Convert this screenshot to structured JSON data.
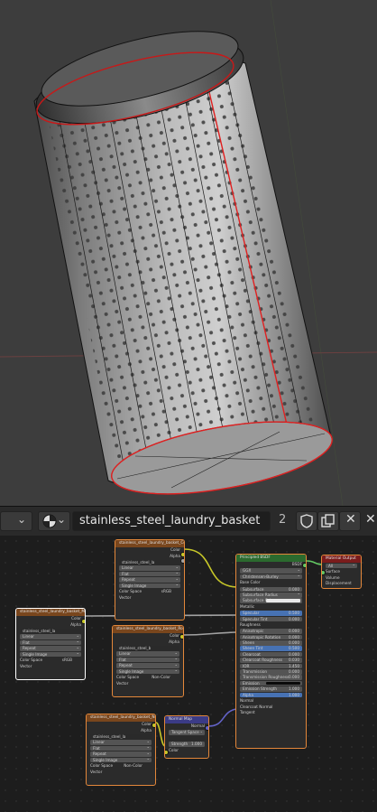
{
  "material_name": "stainless_steel_laundry_basket",
  "user_count": "2",
  "icons": {
    "editor_type": "node-editor-icon",
    "material_slot": "material-sphere-icon",
    "fake_user": "shield-icon",
    "duplicate": "duplicate-icon",
    "unlink": "close-icon",
    "pin": "pin-icon"
  },
  "colors": {
    "viewport_bg": "#3d3d3d",
    "editor_bg": "#1d1d1d",
    "texture_header": "#79461d",
    "bsdf_header": "#2b6a2e",
    "output_header": "#7a1c1c",
    "vector_header": "#3b3b86",
    "selection": "#e3873a",
    "edge_seam": "#e02020"
  },
  "nodes": {
    "tex_color": {
      "title": "stainless_steel_laundry_basket_Co.jpg",
      "out_color": "Color",
      "out_alpha": "Alpha",
      "image": "stainless_steel_la",
      "interpolation": "Linear",
      "projection": "Flat",
      "extension": "Repeat",
      "source": "Single Image",
      "colorspace_label": "Color Space",
      "colorspace": "sRGB",
      "vector": "Vector"
    },
    "tex_metal": {
      "title": "stainless_steel_laundry_basket_Metal.jpg",
      "out_color": "Color",
      "out_alpha": "Alpha",
      "image": "stainless_steel_la",
      "interpolation": "Linear",
      "projection": "Flat",
      "extension": "Repeat",
      "source": "Single Image",
      "colorspace_label": "Color Space",
      "colorspace": "sRGB",
      "vector": "Vector"
    },
    "tex_rough": {
      "title": "stainless_steel_laundry_basket_Rough.jpg",
      "out_color": "Color",
      "out_alpha": "Alpha",
      "image": "stainless_steel_b",
      "interpolation": "Linear",
      "projection": "Flat",
      "extension": "Repeat",
      "source": "Single Image",
      "colorspace_label": "Color Space",
      "colorspace": "Non-Color",
      "vector": "Vector"
    },
    "tex_normal": {
      "title": "stainless_steel_laundry_basket_Normal.jpg",
      "out_color": "Color",
      "out_alpha": "Alpha",
      "image": "stainless_steel_la",
      "interpolation": "Linear",
      "projection": "Flat",
      "extension": "Repeat",
      "source": "Single Image",
      "colorspace_label": "Color Space",
      "colorspace": "Non-Color",
      "vector": "Vector"
    },
    "normal_map": {
      "title": "Normal Map",
      "out_normal": "Normal",
      "space": "Tangent Space",
      "uv": "",
      "strength_label": "Strength",
      "strength": "1.000",
      "in_color": "Color"
    },
    "bsdf": {
      "title": "Principled BSDF",
      "out_bsdf": "BSDF",
      "distribution": "GGX",
      "subsurface_method": "Christensen-Burley",
      "rows": [
        {
          "label": "Base Color",
          "value": "",
          "kind": "socket"
        },
        {
          "label": "Subsurface",
          "value": "0.000",
          "kind": "field"
        },
        {
          "label": "Subsurface Radius",
          "value": "",
          "kind": "drop"
        },
        {
          "label": "Subsurface Col",
          "value": "",
          "kind": "color"
        },
        {
          "label": "Metallic",
          "value": "",
          "kind": "socket"
        },
        {
          "label": "Specular",
          "value": "0.500",
          "kind": "blue"
        },
        {
          "label": "Specular Tint",
          "value": "0.000",
          "kind": "field"
        },
        {
          "label": "Roughness",
          "value": "",
          "kind": "socket"
        },
        {
          "label": "Anisotropic",
          "value": "0.000",
          "kind": "field"
        },
        {
          "label": "Anisotropic Rotation",
          "value": "0.000",
          "kind": "field"
        },
        {
          "label": "Sheen",
          "value": "0.000",
          "kind": "field"
        },
        {
          "label": "Sheen Tint",
          "value": "0.500",
          "kind": "blue"
        },
        {
          "label": "Clearcoat",
          "value": "0.000",
          "kind": "field"
        },
        {
          "label": "Clearcoat Roughness",
          "value": "0.030",
          "kind": "field"
        },
        {
          "label": "IOR",
          "value": "1.450",
          "kind": "field"
        },
        {
          "label": "Transmission",
          "value": "0.000",
          "kind": "field"
        },
        {
          "label": "Transmission Roughness",
          "value": "0.000",
          "kind": "field"
        },
        {
          "label": "Emission",
          "value": "",
          "kind": "emission"
        },
        {
          "label": "Emission Strength",
          "value": "1.000",
          "kind": "field"
        },
        {
          "label": "Alpha",
          "value": "1.000",
          "kind": "blue"
        },
        {
          "label": "Normal",
          "value": "",
          "kind": "socket"
        },
        {
          "label": "Clearcoat Normal",
          "value": "",
          "kind": "socket"
        },
        {
          "label": "Tangent",
          "value": "",
          "kind": "socket"
        }
      ]
    },
    "output": {
      "title": "Material Output",
      "target": "All",
      "in_surface": "Surface",
      "in_volume": "Volume",
      "in_displacement": "Displacement"
    }
  }
}
